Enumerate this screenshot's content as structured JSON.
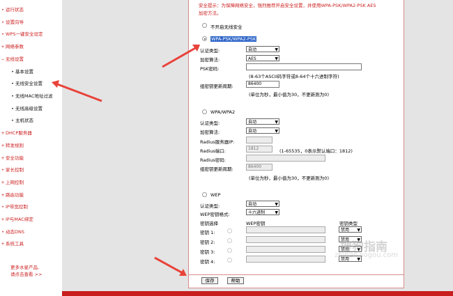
{
  "sidebar": {
    "items": [
      {
        "label": "运行状态",
        "sub": false
      },
      {
        "label": "设置向导",
        "sub": false
      },
      {
        "label": "WPS一键安全设定",
        "sub": false
      },
      {
        "label": "网络参数",
        "sub": false
      },
      {
        "label": "无线设置",
        "sub": false
      },
      {
        "label": "基本设置",
        "sub": true
      },
      {
        "label": "无线安全设置",
        "sub": true
      },
      {
        "label": "无线MAC地址过滤",
        "sub": true
      },
      {
        "label": "无线高级设置",
        "sub": true
      },
      {
        "label": "主机状态",
        "sub": true
      },
      {
        "label": "DHCP服务器",
        "sub": false
      },
      {
        "label": "转发规则",
        "sub": false
      },
      {
        "label": "安全功能",
        "sub": false
      },
      {
        "label": "家长控制",
        "sub": false
      },
      {
        "label": "上网控制",
        "sub": false
      },
      {
        "label": "路由功能",
        "sub": false
      },
      {
        "label": "IP带宽控制",
        "sub": false
      },
      {
        "label": "IP与MAC绑定",
        "sub": false
      },
      {
        "label": "动态DNS",
        "sub": false
      },
      {
        "label": "系统工具",
        "sub": false
      }
    ],
    "more_line1": "更多水星产品,",
    "more_line2": "请点击查看 >>"
  },
  "notice": {
    "line1": "安全提示：为保障网络安全，强烈推荐开启安全设置，并使用WPA-PSK/WPA2-PSK AES",
    "line2": "加密方法。"
  },
  "options": {
    "disable": "不开启无线安全",
    "wpa_psk": "WPA-PSK/WPA2-PSK",
    "wpa": "WPA/WPA2",
    "wep": "WEP"
  },
  "psk": {
    "auth_label": "认证类型:",
    "auth_value": "自动",
    "enc_label": "加密算法:",
    "enc_value": "AES",
    "pwd_label": "PSK密码:",
    "pwd_hint": "(8-63个ASCII码字符或8-64个十六进制字符)",
    "period_label": "组密钥更新周期:",
    "period_value": "86400",
    "period_hint": "(单位为秒，最小值为30，不更新则为0)"
  },
  "wpa": {
    "auth_label": "认证类型:",
    "auth_value": "自动",
    "enc_label": "加密算法:",
    "enc_value": "自动",
    "radius_ip_label": "Radius服务器IP:",
    "radius_port_label": "Radius端口:",
    "radius_port_value": "1812",
    "radius_port_hint": "(1-65535，0表示默认端口：1812)",
    "radius_pwd_label": "Radius密码:",
    "period_label": "组密钥更新周期:",
    "period_value": "86400",
    "period_hint": "(单位为秒，最小值为30，不更新则为0)"
  },
  "wep": {
    "auth_label": "认证类型:",
    "auth_value": "自动",
    "format_label": "WEP密钥格式:",
    "format_value": "十六进制",
    "col_select": "密钥选择",
    "col_key": "WEP密钥",
    "col_type": "密钥类型",
    "keys": [
      {
        "label": "密钥 1:",
        "type": "禁用"
      },
      {
        "label": "密钥 2:",
        "type": "禁用"
      },
      {
        "label": "密钥 3:",
        "type": "禁用"
      },
      {
        "label": "密钥 4:",
        "type": "禁用"
      }
    ]
  },
  "buttons": {
    "save": "保存",
    "help": "帮助"
  },
  "watermark": {
    "brand": "搜狗指南",
    "url": "zhinan.sogou.com"
  },
  "colors": {
    "accent": "#c81e1e",
    "annotation_arrow": "#e8433a"
  }
}
